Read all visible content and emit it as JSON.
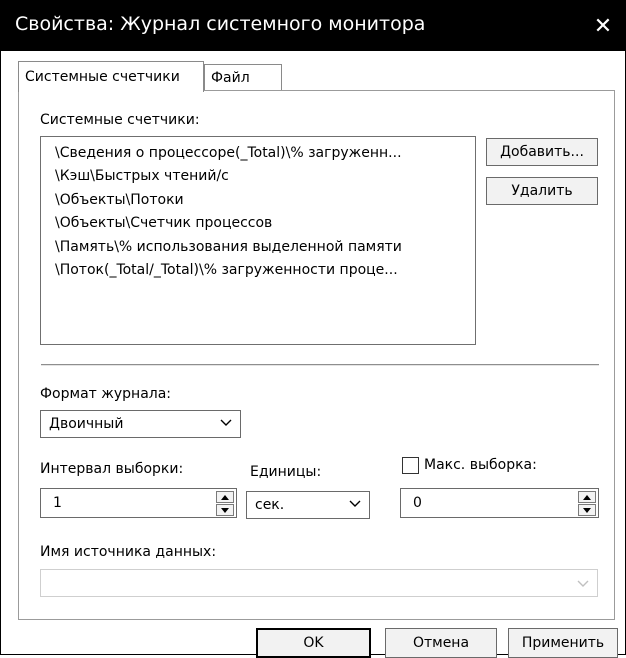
{
  "window": {
    "title": "Свойства: Журнал системного монитора",
    "close_glyph": "✕"
  },
  "tabs": [
    {
      "label": "Системные счетчики",
      "active": true
    },
    {
      "label": "Файл",
      "active": false
    }
  ],
  "counters": {
    "label": "Системные счетчики:",
    "items": [
      "\\Сведения о процессоре(_Total)\\% загруженн...",
      "\\Кэш\\Быстрых чтений/с",
      "\\Объекты\\Потоки",
      "\\Объекты\\Счетчик процессов",
      "\\Память\\% использования выделенной памяти",
      "\\Поток(_Total/_Total)\\% загруженности проце..."
    ],
    "add_button": "Добавить...",
    "remove_button": "Удалить"
  },
  "log_format": {
    "label": "Формат журнала:",
    "value": "Двоичный"
  },
  "sample_interval": {
    "label": "Интервал выборки:",
    "value": "1"
  },
  "units": {
    "label": "Единицы:",
    "value": "сек."
  },
  "max_samples": {
    "label": "Макс. выборка:",
    "value": "0",
    "checked": false
  },
  "data_source": {
    "label": "Имя источника данных:",
    "value": ""
  },
  "footer": {
    "ok": "OK",
    "cancel": "Отмена",
    "apply": "Применить"
  },
  "colors": {
    "titlebar": "#000000",
    "background": "#ffffff"
  }
}
